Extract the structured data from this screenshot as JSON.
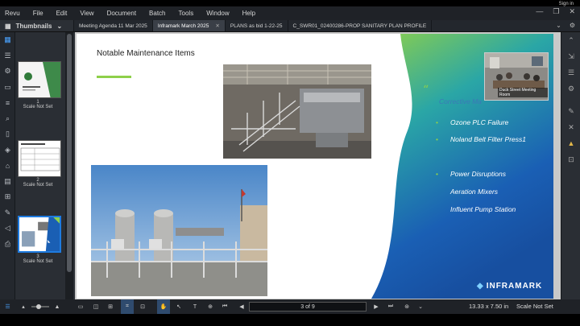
{
  "menu": [
    "Revu",
    "File",
    "Edit",
    "View",
    "Document",
    "Batch",
    "Tools",
    "Window",
    "Help"
  ],
  "sign_in": "Sign in",
  "panel_title": "Thumbnails",
  "tabs": [
    {
      "label": "Meeting Agenda 11 Mar 2025"
    },
    {
      "label": "Inframark March 2025"
    },
    {
      "label": "PLANS as bid 1-22-25"
    },
    {
      "label": "C_SWR01_02400286-PROP SANITARY PLAN  PROFILE"
    }
  ],
  "thumbnails": [
    {
      "number": "1",
      "scale": "Scale Not Set"
    },
    {
      "number": "2",
      "scale": "Scale Not Set"
    },
    {
      "number": "3",
      "scale": "Scale Not Set"
    }
  ],
  "slide": {
    "title": "Notable Maintenance  Items",
    "quote_mark": "“",
    "corrective": "Corrective Ma",
    "bullets": [
      "Ozone PLC Failure",
      "Noland Belt Filter Press1",
      "Power Disruptions",
      "Aeration Mixers",
      "Influent Pump Station"
    ],
    "logo_text": "INFRAMARK",
    "colors": {
      "accent_green": "#8ed04a",
      "blue": "#1a5fb4",
      "teal": "#2aa6a6"
    }
  },
  "video": {
    "label": "Duck Street Meeting Room"
  },
  "statusbar": {
    "page_display": "3 of 9",
    "dimensions": "13.33 x 7.50 in",
    "scale": "Scale Not Set"
  }
}
